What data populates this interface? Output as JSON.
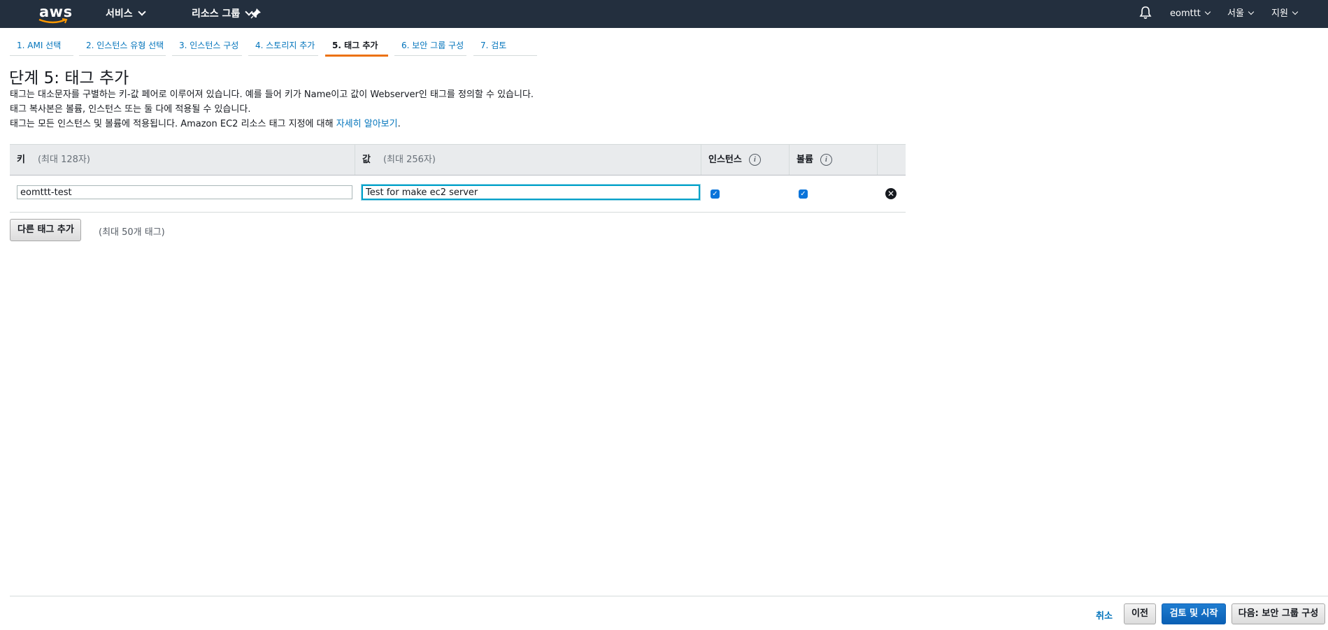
{
  "topbar": {
    "logo_text": "aws",
    "services_label": "서비스",
    "resource_groups_label": "리소스 그룹",
    "pin_icon": "pin-icon",
    "bell_icon": "bell-icon",
    "user": "eomttt",
    "region": "서울",
    "support": "지원"
  },
  "wizard": {
    "tabs": [
      {
        "label": "1. AMI 선택"
      },
      {
        "label": "2. 인스턴스 유형 선택"
      },
      {
        "label": "3. 인스턴스 구성"
      },
      {
        "label": "4. 스토리지 추가"
      },
      {
        "label": "5. 태그 추가"
      },
      {
        "label": "6. 보안 그룹 구성"
      },
      {
        "label": "7. 검토"
      }
    ],
    "active_tab": 4
  },
  "page": {
    "title": "단계 5: 태그 추가",
    "desc1": "태그는 대소문자를 구별하는 키-값 페어로 이루어져 있습니다. 예를 들어 키가 Name이고 값이 Webserver인 태그를 정의할 수 있습니다.",
    "desc2": "태그 복사본은 볼륨, 인스턴스 또는 둘 다에 적용될 수 있습니다.",
    "desc3": "태그는 모든 인스턴스 및 볼륨에 적용됩니다. Amazon EC2 리소스 태그 지정에 대해",
    "learn_more": "자세히 알아보기",
    "desc3_end": "."
  },
  "table": {
    "headers": {
      "key": "키",
      "key_hint": "(최대 128자)",
      "value": "값",
      "value_hint": "(최대 256자)",
      "instances": "인스턴스",
      "volumes": "볼륨",
      "info_glyph": "i"
    },
    "rows": [
      {
        "key": "eomttt-test",
        "value": "Test for make ec2 server",
        "instances": true,
        "volumes": true
      }
    ]
  },
  "actions": {
    "add_tag": "다른 태그 추가",
    "add_tag_hint": "(최대 50개 태그)",
    "cancel": "취소",
    "previous": "이전",
    "review_launch": "검토 및 시작",
    "next": "다음: 보안 그룹 구성"
  },
  "colors": {
    "topbar": "#232f3e",
    "link": "#0073bb",
    "active_tab": "#ec7211",
    "primary": "#0a5fb5"
  }
}
